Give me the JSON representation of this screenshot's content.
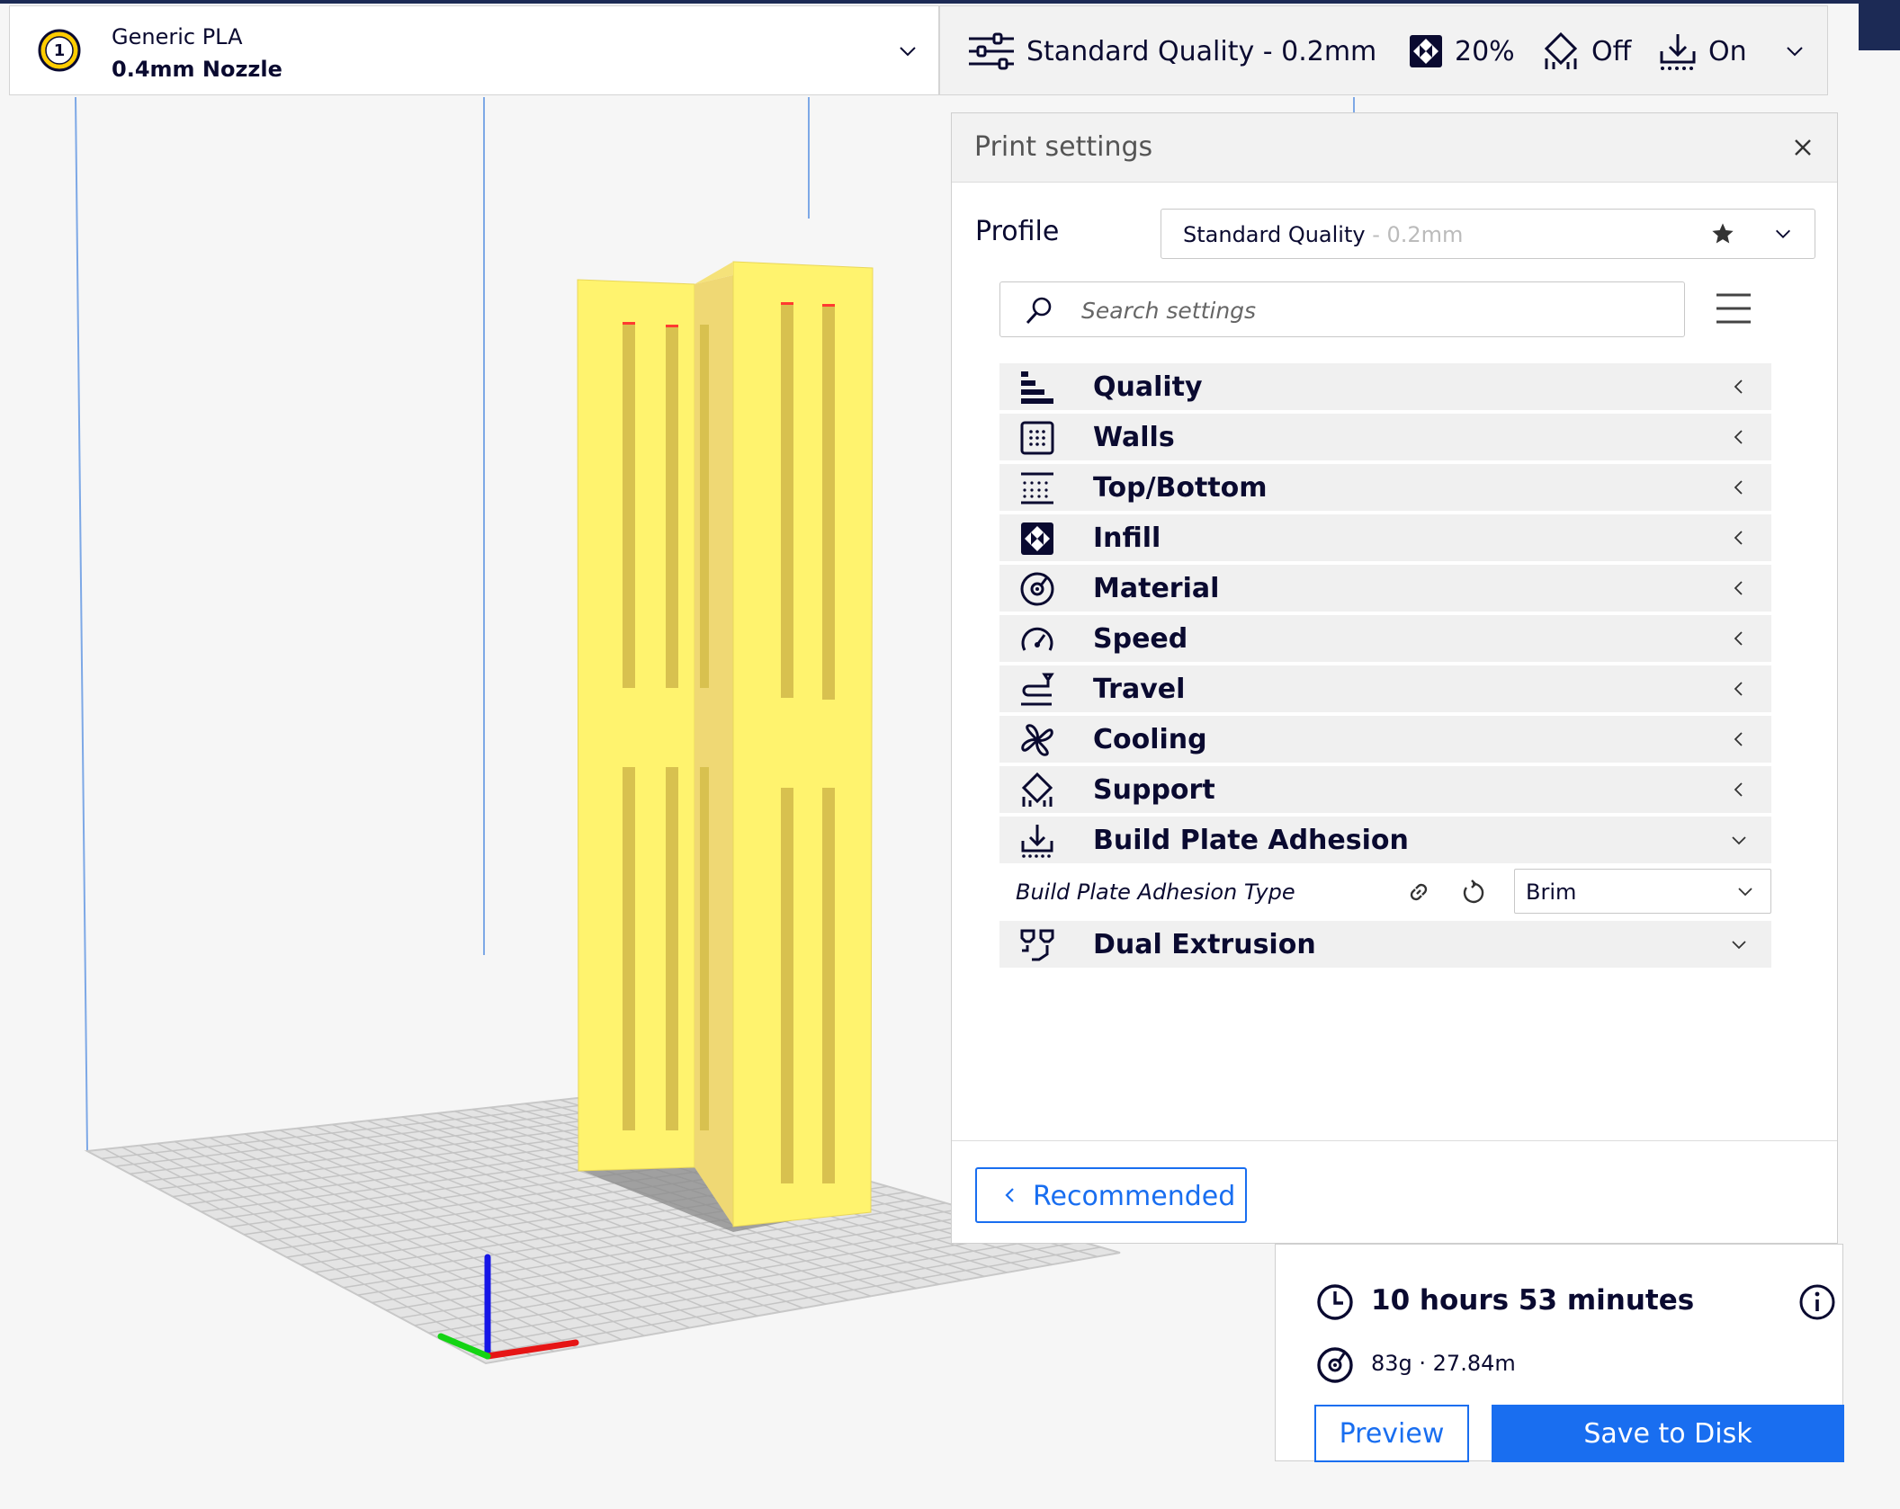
{
  "extruder": {
    "number": "1",
    "material": "Generic PLA",
    "nozzle": "0.4mm Nozzle",
    "icons": {
      "badge": "extruder-badge-icon",
      "expand": "chevron-down-icon"
    }
  },
  "settings_bar": {
    "quality": "Standard Quality - 0.2mm",
    "infill": "20%",
    "support": "Off",
    "adhesion": "On",
    "icons": [
      "sliders-icon",
      "infill-icon",
      "support-icon",
      "adhesion-icon",
      "chevron-down-icon"
    ]
  },
  "print_settings": {
    "title": "Print settings",
    "profile_label": "Profile",
    "profile_name": "Standard Quality",
    "profile_layer": " - 0.2mm",
    "search_placeholder": "Search settings",
    "categories": [
      {
        "label": "Quality",
        "icon": "quality-icon",
        "expanded": false
      },
      {
        "label": "Walls",
        "icon": "walls-icon",
        "expanded": false
      },
      {
        "label": "Top/Bottom",
        "icon": "top-bottom-icon",
        "expanded": false
      },
      {
        "label": "Infill",
        "icon": "infill-icon",
        "expanded": false
      },
      {
        "label": "Material",
        "icon": "material-icon",
        "expanded": false
      },
      {
        "label": "Speed",
        "icon": "speed-icon",
        "expanded": false
      },
      {
        "label": "Travel",
        "icon": "travel-icon",
        "expanded": false
      },
      {
        "label": "Cooling",
        "icon": "cooling-fan-icon",
        "expanded": false
      },
      {
        "label": "Support",
        "icon": "support-icon",
        "expanded": false
      },
      {
        "label": "Build Plate Adhesion",
        "icon": "adhesion-icon",
        "expanded": true
      },
      {
        "label": "Dual Extrusion",
        "icon": "dual-extrusion-icon",
        "expanded": true
      }
    ],
    "adhesion_setting": {
      "label": "Build Plate Adhesion Type",
      "value": "Brim"
    },
    "recommended_label": "Recommended"
  },
  "estimate": {
    "time": "10 hours 53 minutes",
    "material": "83g · 27.84m",
    "preview_label": "Preview",
    "save_label": "Save to Disk"
  },
  "colors": {
    "accent": "#196ef0",
    "model": "#fff36e",
    "panel_header": "#f2f2f2",
    "text": "#0a0a30"
  }
}
